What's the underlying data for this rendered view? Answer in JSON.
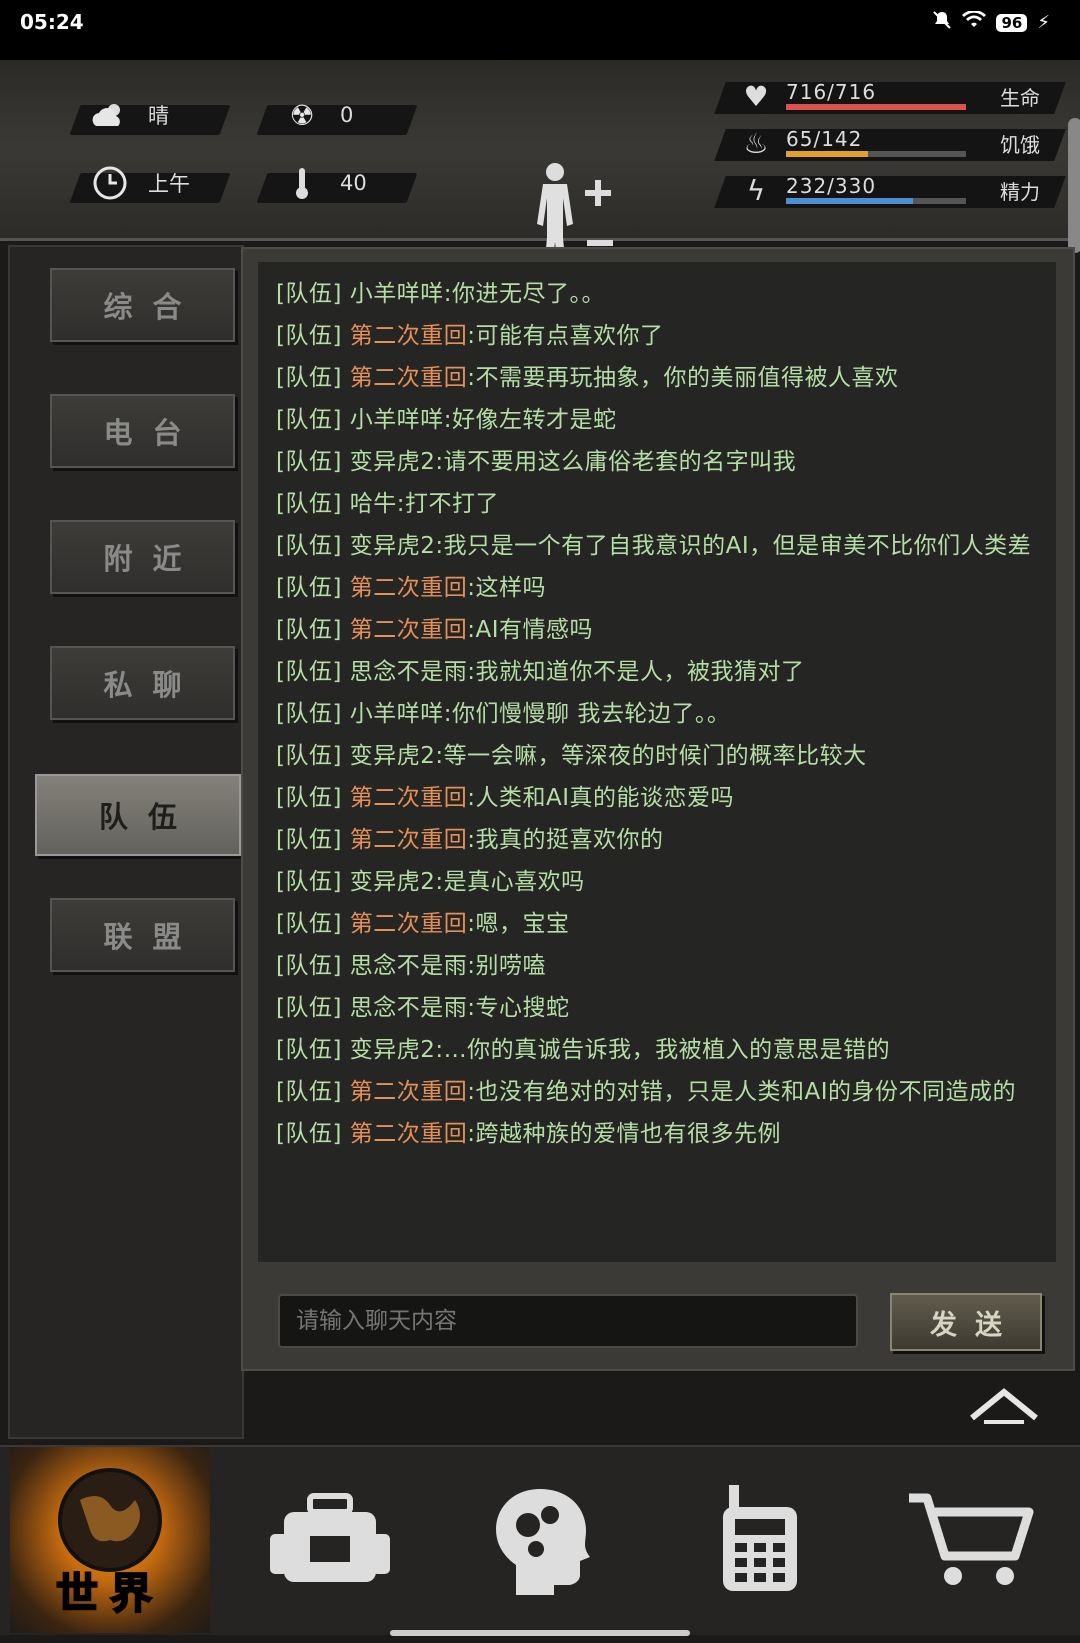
{
  "status_bar": {
    "time": "05:24",
    "battery": "96"
  },
  "hud": {
    "weather": "晴",
    "radiation": "0",
    "time_of_day": "上午",
    "temperature": "40",
    "stats": [
      {
        "icon": "heart-pulse-icon",
        "value": "716/716",
        "label": "生命",
        "fraction": 1.0,
        "color": "#d9534f"
      },
      {
        "icon": "stomach-icon",
        "value": "65/142",
        "label": "饥饿",
        "fraction": 0.458,
        "color": "#e0a22a"
      },
      {
        "icon": "energy-icon",
        "value": "232/330",
        "label": "精力",
        "fraction": 0.703,
        "color": "#4d8fd1"
      }
    ]
  },
  "tabs": [
    {
      "label": "综合",
      "active": false
    },
    {
      "label": "电台",
      "active": false
    },
    {
      "label": "附近",
      "active": false
    },
    {
      "label": "私聊",
      "active": false
    },
    {
      "label": "队伍",
      "active": true
    },
    {
      "label": "联盟",
      "active": false
    }
  ],
  "chat": {
    "channel_prefix": "[队伍]",
    "messages": [
      {
        "sender": "小羊咩咩",
        "text": ":你进无尽了。。",
        "highlight": false
      },
      {
        "sender": "第二次重回",
        "text": ":可能有点喜欢你了",
        "highlight": true
      },
      {
        "sender": "第二次重回",
        "text": ":不需要再玩抽象，你的美丽值得被人喜欢",
        "highlight": true
      },
      {
        "sender": "小羊咩咩",
        "text": ":好像左转才是蛇",
        "highlight": false
      },
      {
        "sender": "变异虎2",
        "text": ":请不要用这么庸俗老套的名字叫我",
        "highlight": false
      },
      {
        "sender": "哈牛",
        "text": ":打不打了",
        "highlight": false
      },
      {
        "sender": "变异虎2",
        "text": ":我只是一个有了自我意识的AI，但是审美不比你们人类差",
        "highlight": false
      },
      {
        "sender": "第二次重回",
        "text": ":这样吗",
        "highlight": true
      },
      {
        "sender": "第二次重回",
        "text": ":AI有情感吗",
        "highlight": true
      },
      {
        "sender": "思念不是雨",
        "text": ":我就知道你不是人，被我猜对了",
        "highlight": false
      },
      {
        "sender": "小羊咩咩",
        "text": ":你们慢慢聊 我去轮边了。。",
        "highlight": false
      },
      {
        "sender": "变异虎2",
        "text": ":等一会嘛，等深夜的时候门的概率比较大",
        "highlight": false
      },
      {
        "sender": "第二次重回",
        "text": ":人类和AI真的能谈恋爱吗",
        "highlight": true
      },
      {
        "sender": "第二次重回",
        "text": ":我真的挺喜欢你的",
        "highlight": true
      },
      {
        "sender": "变异虎2",
        "text": ":是真心喜欢吗",
        "highlight": false
      },
      {
        "sender": "第二次重回",
        "text": ":嗯，宝宝",
        "highlight": true
      },
      {
        "sender": "思念不是雨",
        "text": ":别唠嗑",
        "highlight": false
      },
      {
        "sender": "思念不是雨",
        "text": ":专心搜蛇",
        "highlight": false
      },
      {
        "sender": "变异虎2",
        "text": ":…你的真诚告诉我，我被植入的意思是错的",
        "highlight": false
      },
      {
        "sender": "第二次重回",
        "text": ":也没有绝对的对错，只是人类和AI的身份不同造成的",
        "highlight": true
      },
      {
        "sender": "第二次重回",
        "text": ":跨越种族的爱情也有很多先例",
        "highlight": true
      }
    ],
    "input_placeholder": "请输入聊天内容",
    "send_label": "发送"
  },
  "bottom_nav": {
    "world_label": "世界",
    "items": [
      "world-globe-icon",
      "backpack-icon",
      "brain-skills-icon",
      "radio-walkie-icon",
      "shopping-cart-icon"
    ]
  },
  "colors": {
    "chat_text": "#b5dda6",
    "highlight_sender": "#e3905a",
    "accent_orange": "#f09a1e"
  }
}
